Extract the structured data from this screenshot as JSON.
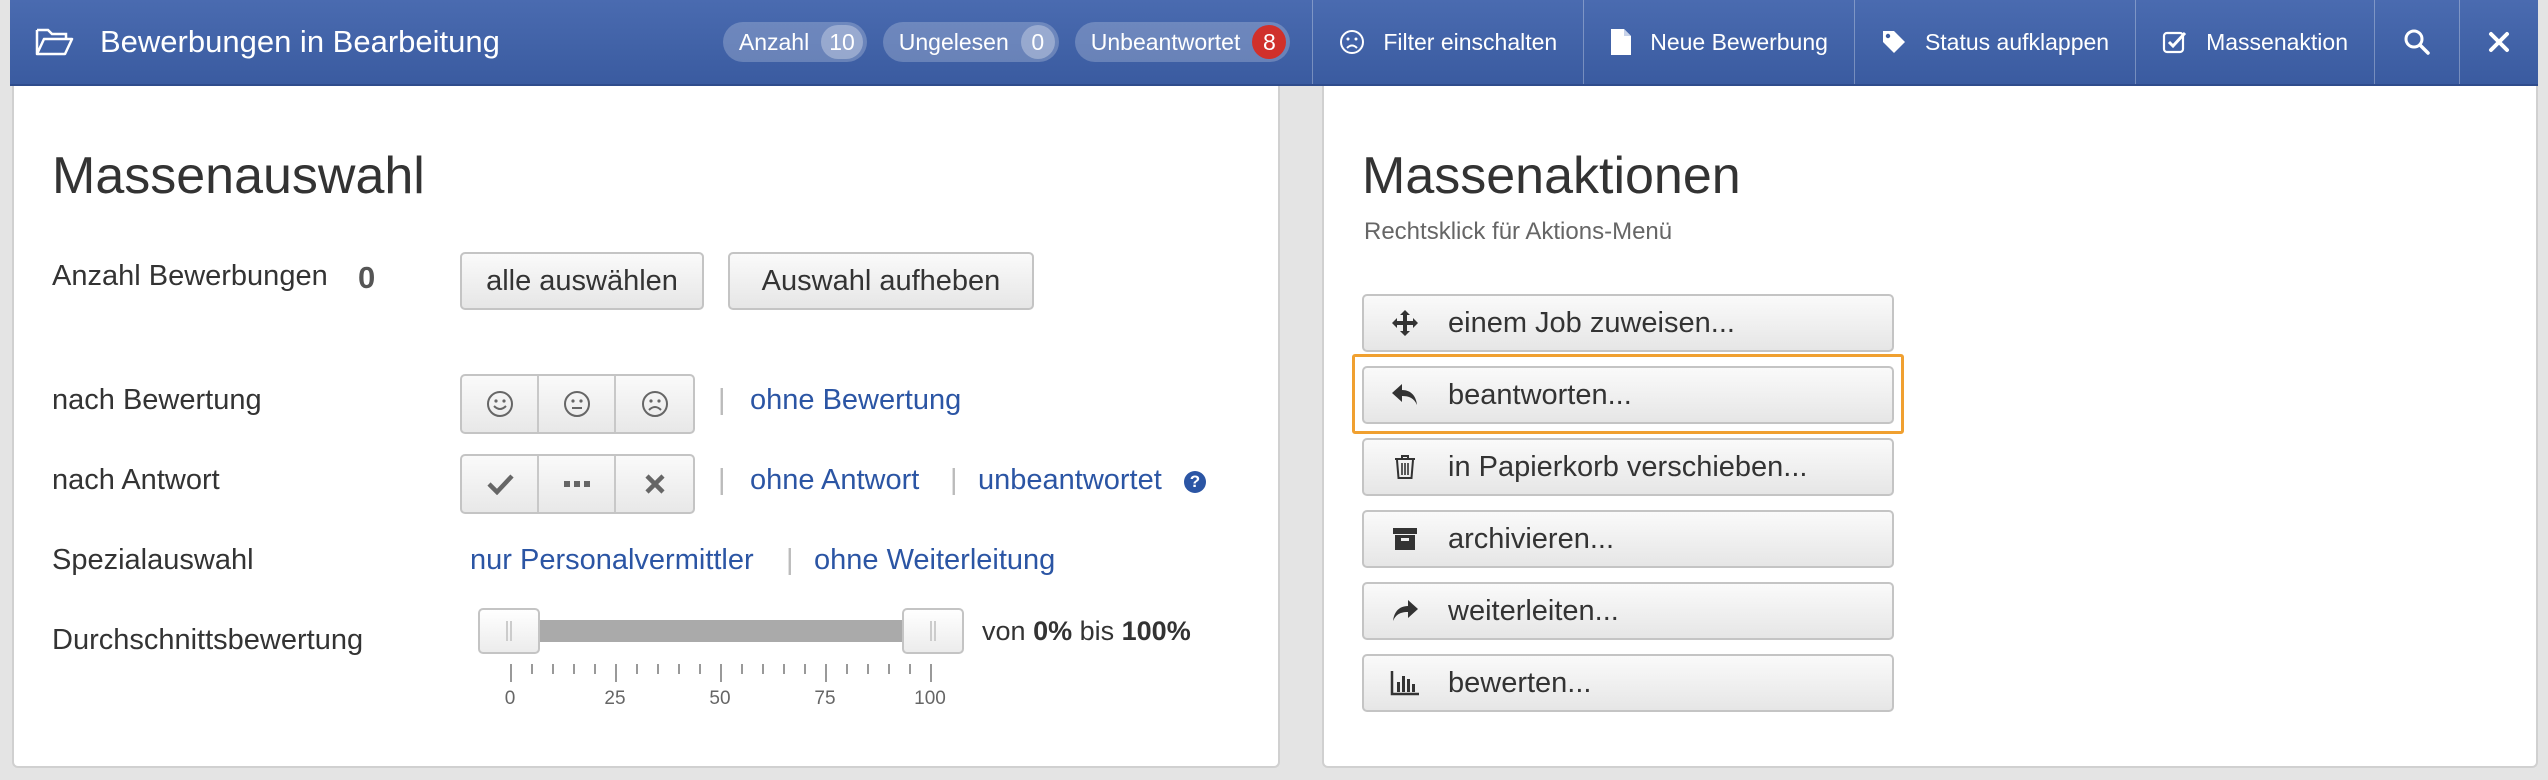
{
  "header": {
    "title": "Bewerbungen in Bearbeitung",
    "badges": [
      {
        "label": "Anzahl",
        "count": "10"
      },
      {
        "label": "Ungelesen",
        "count": "0"
      },
      {
        "label": "Unbeantwortet",
        "count": "8"
      }
    ],
    "buttons": {
      "filter": "Filter einschalten",
      "new": "Neue Bewerbung",
      "status": "Status aufklappen",
      "mass": "Massenaktion"
    },
    "icons": [
      "folder-open-icon",
      "frown-icon",
      "file-icon",
      "tag-icon",
      "check-square-icon",
      "search-icon",
      "close-icon"
    ]
  },
  "left": {
    "title": "Massenauswahl",
    "anzahl_label": "Anzahl Bewerbungen",
    "anzahl_value": "0",
    "select_all": "alle auswählen",
    "clear_selection": "Auswahl aufheben",
    "rating_label": "nach Bewertung",
    "rating_none": "ohne Bewertung",
    "answer_label": "nach Antwort",
    "answer_none": "ohne Antwort",
    "answer_unanswered": "unbeantwortet",
    "special_label": "Spezialauswahl",
    "special_agents": "nur Personalvermittler",
    "special_noforward": "ohne Weiterleitung",
    "avg_label": "Durchschnittsbewertung",
    "slider": {
      "min": 0,
      "max": 100,
      "from": 0,
      "to": 100,
      "tick_labels": [
        "0",
        "25",
        "50",
        "75",
        "100"
      ]
    },
    "range_von": "von",
    "range_from": "0%",
    "range_bis": "bis",
    "range_to": "100%"
  },
  "right": {
    "title": "Massenaktionen",
    "subtitle": "Rechtsklick für Aktions-Menü",
    "actions": [
      {
        "label": "einem Job zuweisen...",
        "icon": "move-icon"
      },
      {
        "label": "beantworten...",
        "icon": "reply-icon",
        "focused": true
      },
      {
        "label": "in Papierkorb verschieben...",
        "icon": "trash-icon"
      },
      {
        "label": "archivieren...",
        "icon": "archive-icon"
      },
      {
        "label": "weiterleiten...",
        "icon": "share-icon"
      },
      {
        "label": "bewerten...",
        "icon": "bar-chart-icon"
      }
    ]
  },
  "colors": {
    "header": "#3a5ba0",
    "link": "#2b55a4",
    "badge_red": "#d0302b",
    "focus": "#f0a030"
  }
}
